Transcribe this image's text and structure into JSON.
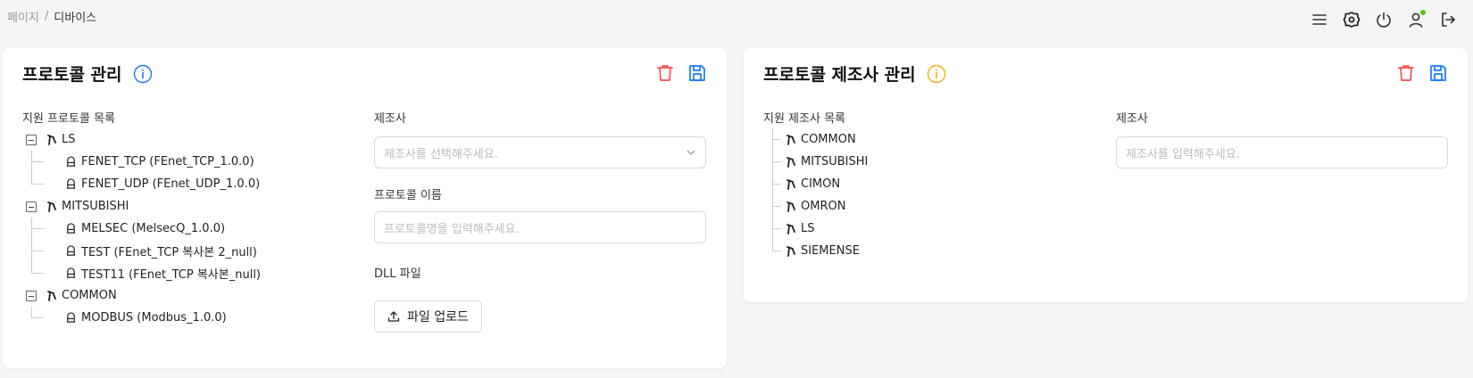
{
  "breadcrumb": {
    "root": "페이지",
    "separator": "/",
    "current": "디바이스"
  },
  "topbar": {
    "icons": [
      "menu-icon",
      "settings-icon",
      "power-icon",
      "user-icon",
      "logout-icon"
    ],
    "status_color": "#52c41a"
  },
  "colors": {
    "delete": "#ff4d4f",
    "save": "#1677ff",
    "info_blue": "#1677ff",
    "info_orange": "#faad14"
  },
  "protocol_card": {
    "title": "프로토콜 관리",
    "tree_label": "지원 프로토콜 목록",
    "tree": [
      {
        "label": "LS",
        "children": [
          "FENET_TCP (FEnet_TCP_1.0.0)",
          "FENET_UDP (FEnet_UDP_1.0.0)"
        ]
      },
      {
        "label": "MITSUBISHI",
        "children": [
          "MELSEC (MelsecQ_1.0.0)",
          "TEST (FEnet_TCP 복사본 2_null)",
          "TEST11 (FEnet_TCP 복사본_null)"
        ]
      },
      {
        "label": "COMMON",
        "children": [
          "MODBUS (Modbus_1.0.0)"
        ]
      }
    ],
    "maker_label": "제조사",
    "maker_placeholder": "제조사를 선택해주세요.",
    "name_label": "프로토콜 이름",
    "name_placeholder": "프로토콜명을 입력해주세요.",
    "dll_label": "DLL 파일",
    "upload_label": "파일 업로드"
  },
  "maker_card": {
    "title": "프로토콜 제조사 관리",
    "list_label": "지원 제조사 목록",
    "makers": [
      "COMMON",
      "MITSUBISHI",
      "CIMON",
      "OMRON",
      "LS",
      "SIEMENSE"
    ],
    "maker_label": "제조사",
    "maker_placeholder": "제조사를 입력해주세요."
  }
}
